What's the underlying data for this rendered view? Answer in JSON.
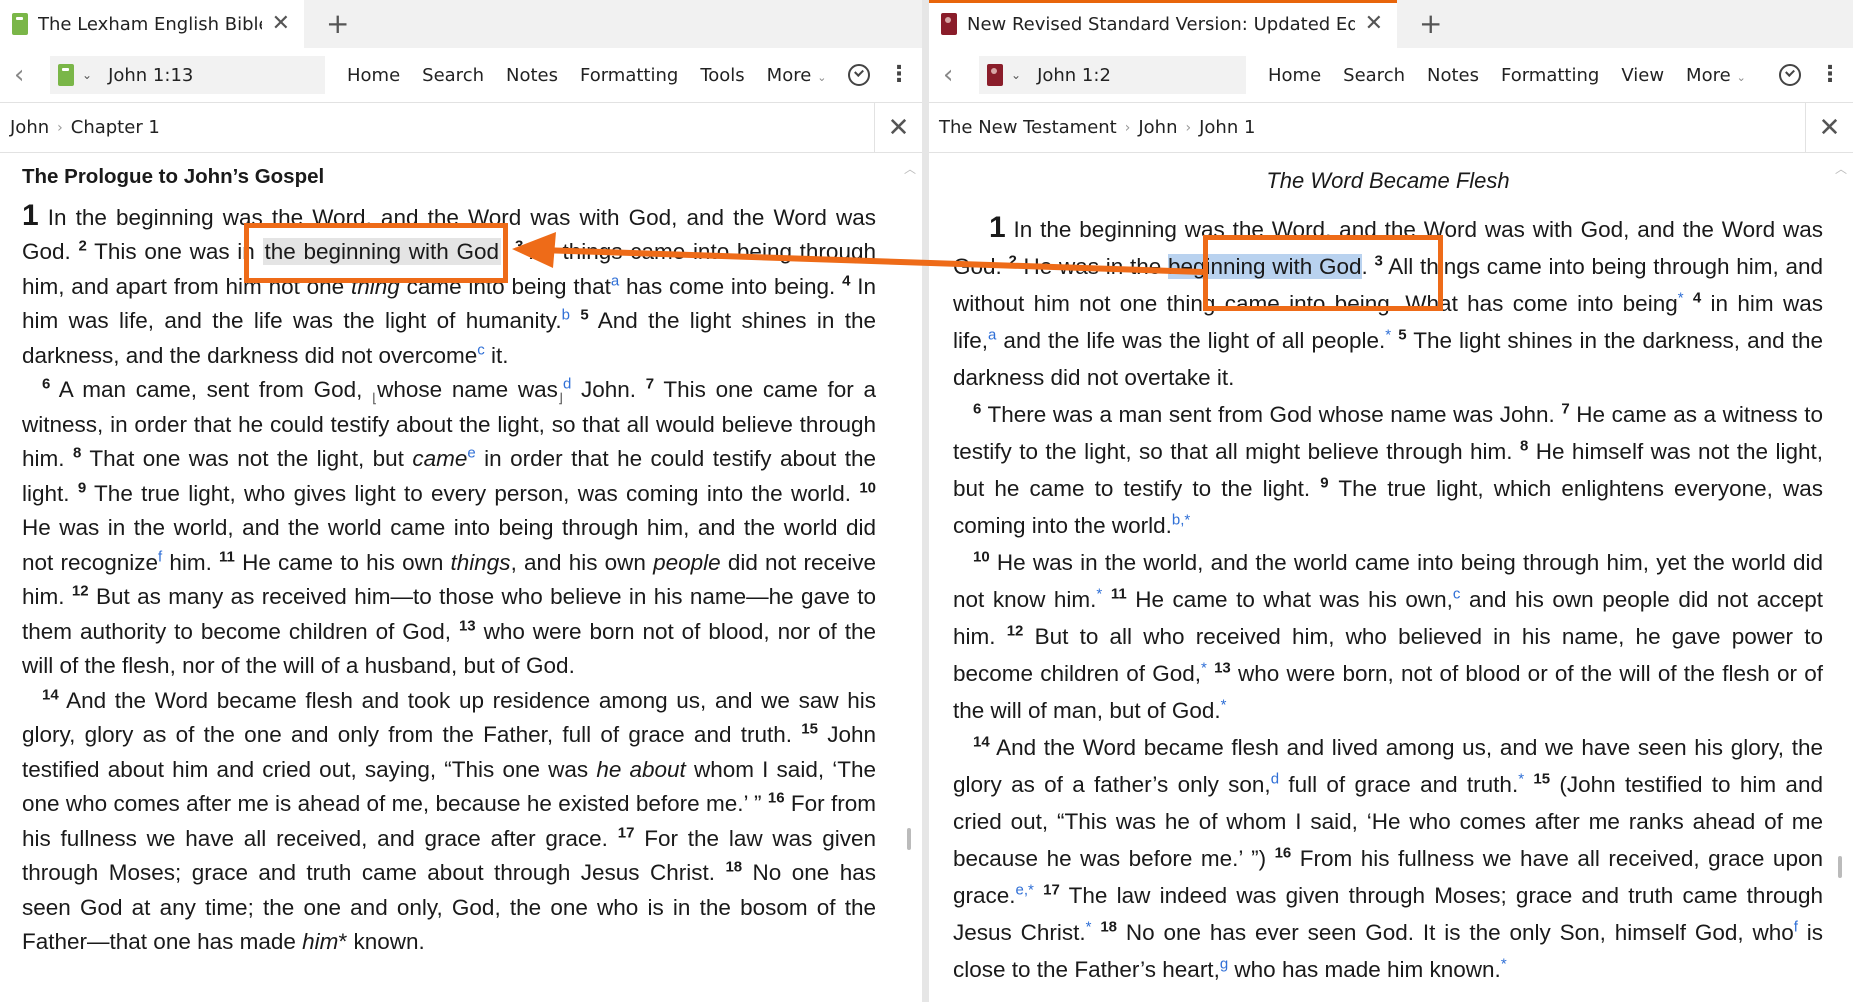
{
  "left": {
    "tab_title": "The Lexham English Bible",
    "reference": "John 1:13",
    "menu": [
      "Home",
      "Search",
      "Notes",
      "Formatting",
      "Tools",
      "More"
    ],
    "breadcrumb": [
      "John",
      "Chapter 1"
    ],
    "heading": "The Prologue to John’s Gospel",
    "highlight": "the beginning with God"
  },
  "right": {
    "tab_title": "New Revised Standard Version: Updated Edition",
    "reference": "John 1:2",
    "menu": [
      "Home",
      "Search",
      "Notes",
      "Formatting",
      "View",
      "More"
    ],
    "breadcrumb": [
      "The New Testament",
      "John",
      "John 1"
    ],
    "heading": "The Word Became Flesh",
    "highlight": "beginning with God"
  },
  "icons": {
    "close": "close-icon",
    "add_tab": "plus-icon",
    "back": "chevron-left-icon",
    "sync": "check-circle-icon",
    "more": "kebab-menu-icon"
  },
  "colors": {
    "accent": "#ee6b18",
    "footnote": "#2f6fd6",
    "highlight_left": "#e4e4e4",
    "highlight_right": "#b9d2ef"
  }
}
